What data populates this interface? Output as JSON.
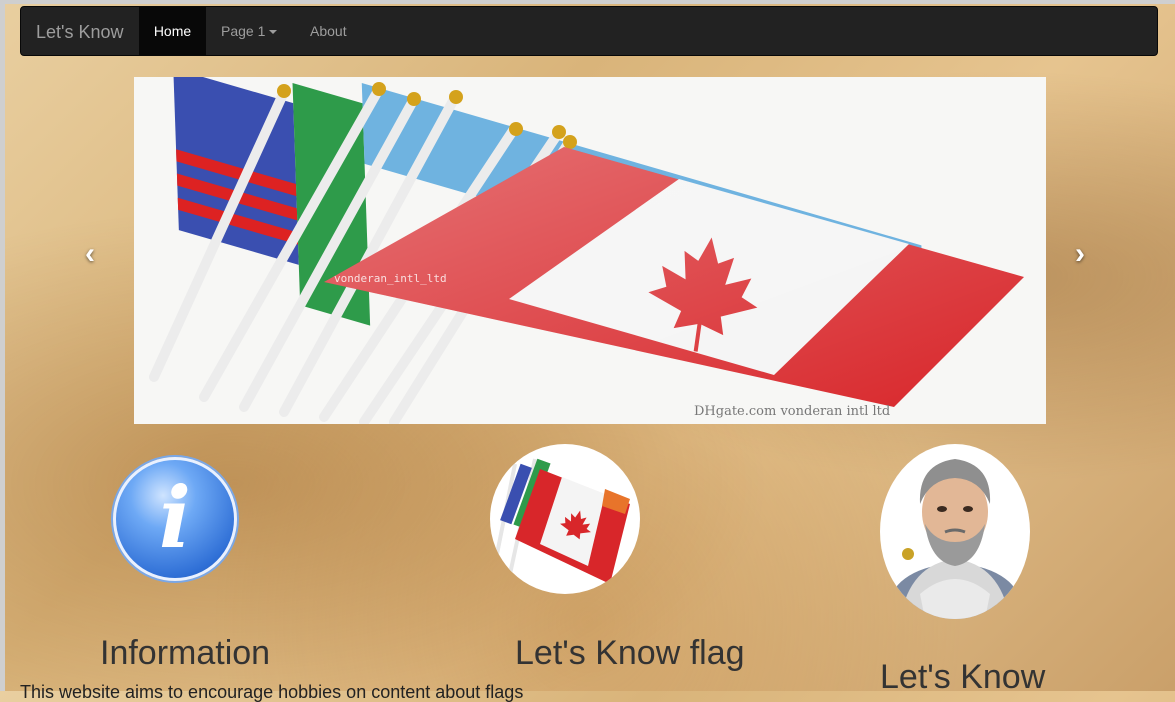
{
  "navbar": {
    "brand": "Let's Know",
    "items": [
      {
        "label": "Home",
        "active": true
      },
      {
        "label": "Page 1",
        "dropdown": true
      },
      {
        "label": "About"
      }
    ]
  },
  "carousel": {
    "prev_icon": "chevron-left-icon",
    "next_icon": "chevron-right-icon",
    "watermark": "DHgate.com  vonderan intl ltd",
    "flag_watermark": "vonderan_intl_ltd"
  },
  "features": [
    {
      "title": "Information",
      "icon": "info-icon"
    },
    {
      "title": "Let's Know flag",
      "icon": "flag-thumbnail"
    },
    {
      "title": "Let's Know",
      "icon": "philosopher-portrait"
    }
  ],
  "body_text": "This website aims to encourage hobbies on content about flags",
  "colors": {
    "navbar_bg": "#222222",
    "active_bg": "#080808",
    "text_muted": "#9d9d9d"
  }
}
